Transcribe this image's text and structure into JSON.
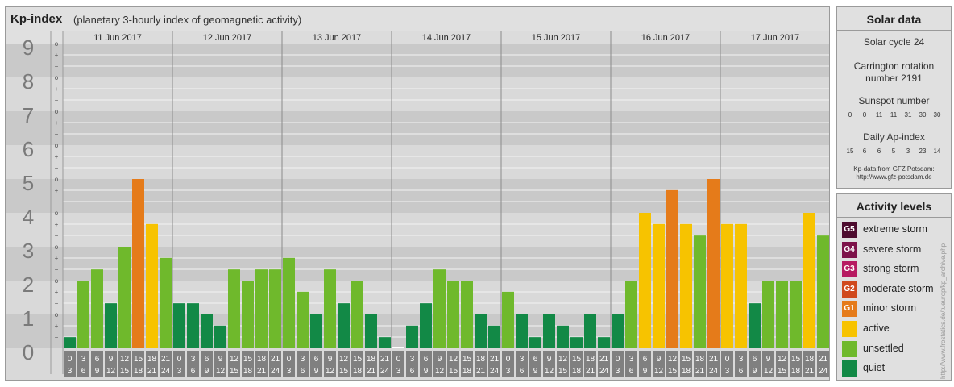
{
  "header": {
    "title": "Kp-index",
    "subtitle": "(planetary 3-hourly index of geomagnetic activity)"
  },
  "colors": {
    "quiet": "#128946",
    "unsettled": "#6fb92c",
    "active": "#f7c300",
    "minor_storm": "#e57b1a",
    "moderate_storm": "#d0491c",
    "strong_storm": "#b71a61",
    "severe_storm": "#7d1249",
    "extreme_storm": "#4d0b2e",
    "band_dark": "#c9c9c9",
    "band_light": "#d9d9d9",
    "tick_box": "#808080"
  },
  "chart_data": {
    "type": "bar",
    "y_ticks": [
      "0",
      "1",
      "2",
      "3",
      "4",
      "5",
      "6",
      "7",
      "8",
      "9"
    ],
    "minor_marks": [
      "+",
      "o",
      "−"
    ],
    "ylim": [
      0,
      9
    ],
    "days": [
      "11 Jun 2017",
      "12 Jun 2017",
      "13 Jun 2017",
      "14 Jun 2017",
      "15 Jun 2017",
      "16 Jun 2017",
      "17 Jun 2017"
    ],
    "intervals": [
      {
        "start": "0",
        "end": "3"
      },
      {
        "start": "3",
        "end": "6"
      },
      {
        "start": "6",
        "end": "9"
      },
      {
        "start": "9",
        "end": "12"
      },
      {
        "start": "12",
        "end": "15"
      },
      {
        "start": "15",
        "end": "18"
      },
      {
        "start": "18",
        "end": "21"
      },
      {
        "start": "21",
        "end": "24"
      }
    ],
    "series": [
      {
        "values": [
          0.33,
          2.0,
          2.33,
          1.33,
          3.0,
          5.0,
          3.67,
          2.67
        ]
      },
      {
        "values": [
          1.33,
          1.33,
          1.0,
          0.67,
          2.33,
          2.0,
          2.33,
          2.33
        ]
      },
      {
        "values": [
          2.67,
          1.67,
          1.0,
          2.33,
          1.33,
          2.0,
          1.0,
          0.33
        ]
      },
      {
        "values": [
          0.0,
          0.67,
          1.33,
          2.33,
          2.0,
          2.0,
          1.0,
          0.67
        ]
      },
      {
        "values": [
          1.67,
          1.0,
          0.33,
          1.0,
          0.67,
          0.33,
          1.0,
          0.33
        ]
      },
      {
        "values": [
          1.0,
          2.0,
          4.0,
          3.67,
          4.67,
          3.67,
          3.33,
          5.0
        ]
      },
      {
        "values": [
          3.67,
          3.67,
          1.33,
          2.0,
          2.0,
          2.0,
          4.0,
          3.33
        ]
      }
    ]
  },
  "solar": {
    "title": "Solar data",
    "solar_cycle": "Solar cycle 24",
    "carrington_line1": "Carrington rotation",
    "carrington_line2": "number 2191",
    "sunspot_label": "Sunspot number",
    "sunspot_values": [
      "0",
      "0",
      "11",
      "11",
      "31",
      "30",
      "30"
    ],
    "ap_label": "Daily Ap-index",
    "ap_values": [
      "15",
      "6",
      "6",
      "5",
      "3",
      "23",
      "14"
    ],
    "credit_line1": "Kp-data from GFZ Potsdam:",
    "credit_line2": "http://www.gfz-potsdam.de"
  },
  "activity": {
    "title": "Activity levels",
    "items": [
      {
        "code": "G5",
        "label": "extreme storm",
        "color": "#4d0b2e"
      },
      {
        "code": "G4",
        "label": "severe storm",
        "color": "#7d1249"
      },
      {
        "code": "G3",
        "label": "strong storm",
        "color": "#b71a61"
      },
      {
        "code": "G2",
        "label": "moderate storm",
        "color": "#d0491c"
      },
      {
        "code": "G1",
        "label": "minor storm",
        "color": "#e57b1a"
      },
      {
        "code": "",
        "label": "active",
        "color": "#f7c300"
      },
      {
        "code": "",
        "label": "unsettled",
        "color": "#6fb92c"
      },
      {
        "code": "",
        "label": "quiet",
        "color": "#128946"
      }
    ]
  },
  "watermark": "http://www.frostatics.de/tueurop/kp_archive.php"
}
